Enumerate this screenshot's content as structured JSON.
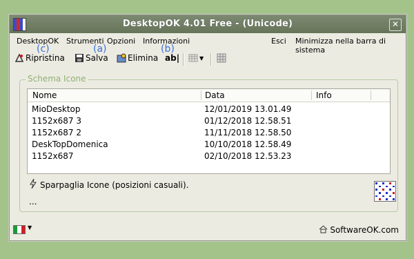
{
  "window": {
    "title": "DesktopOK 4.01 Free - (Unicode)",
    "close_glyph": "✕"
  },
  "menu": {
    "items": [
      "DesktopOK",
      "Strumenti",
      "Opzioni",
      "Informazioni"
    ],
    "right_items": [
      "Esci",
      "Minimizza nella barra di sistema"
    ]
  },
  "toolbar": {
    "restore_label": "Ripristina",
    "save_label": "Salva",
    "delete_label": "Elimina",
    "rename_glyph": "ab|",
    "annotations": {
      "a": "(a)",
      "b": "(b)",
      "c": "(c)"
    }
  },
  "group": {
    "legend": "Schema Icone"
  },
  "list": {
    "headers": [
      "Nome",
      "Data",
      "Info"
    ],
    "rows": [
      {
        "name": "MioDesktop",
        "date": "12/01/2019 13.01.49"
      },
      {
        "name": "1152x687 3",
        "date": "01/12/2018 12.58.51"
      },
      {
        "name": "1152x687 2",
        "date": "11/11/2018 12.58.50"
      },
      {
        "name": "DeskTopDomenica",
        "date": "10/10/2018 12.58.49"
      },
      {
        "name": "1152x687",
        "date": "02/10/2018 12.53.23"
      }
    ]
  },
  "status": {
    "text": "Sparpaglia Icone (posizioni casuali).",
    "dots": "..."
  },
  "footer": {
    "site": "SoftwareOK.com"
  },
  "colors": {
    "title_bg": "#6f7d62",
    "window_bg": "#ecebe2",
    "desktop_bg": "#a3c38b",
    "accent_blue": "#3a6fd8",
    "group_border": "#b6c9a2"
  }
}
